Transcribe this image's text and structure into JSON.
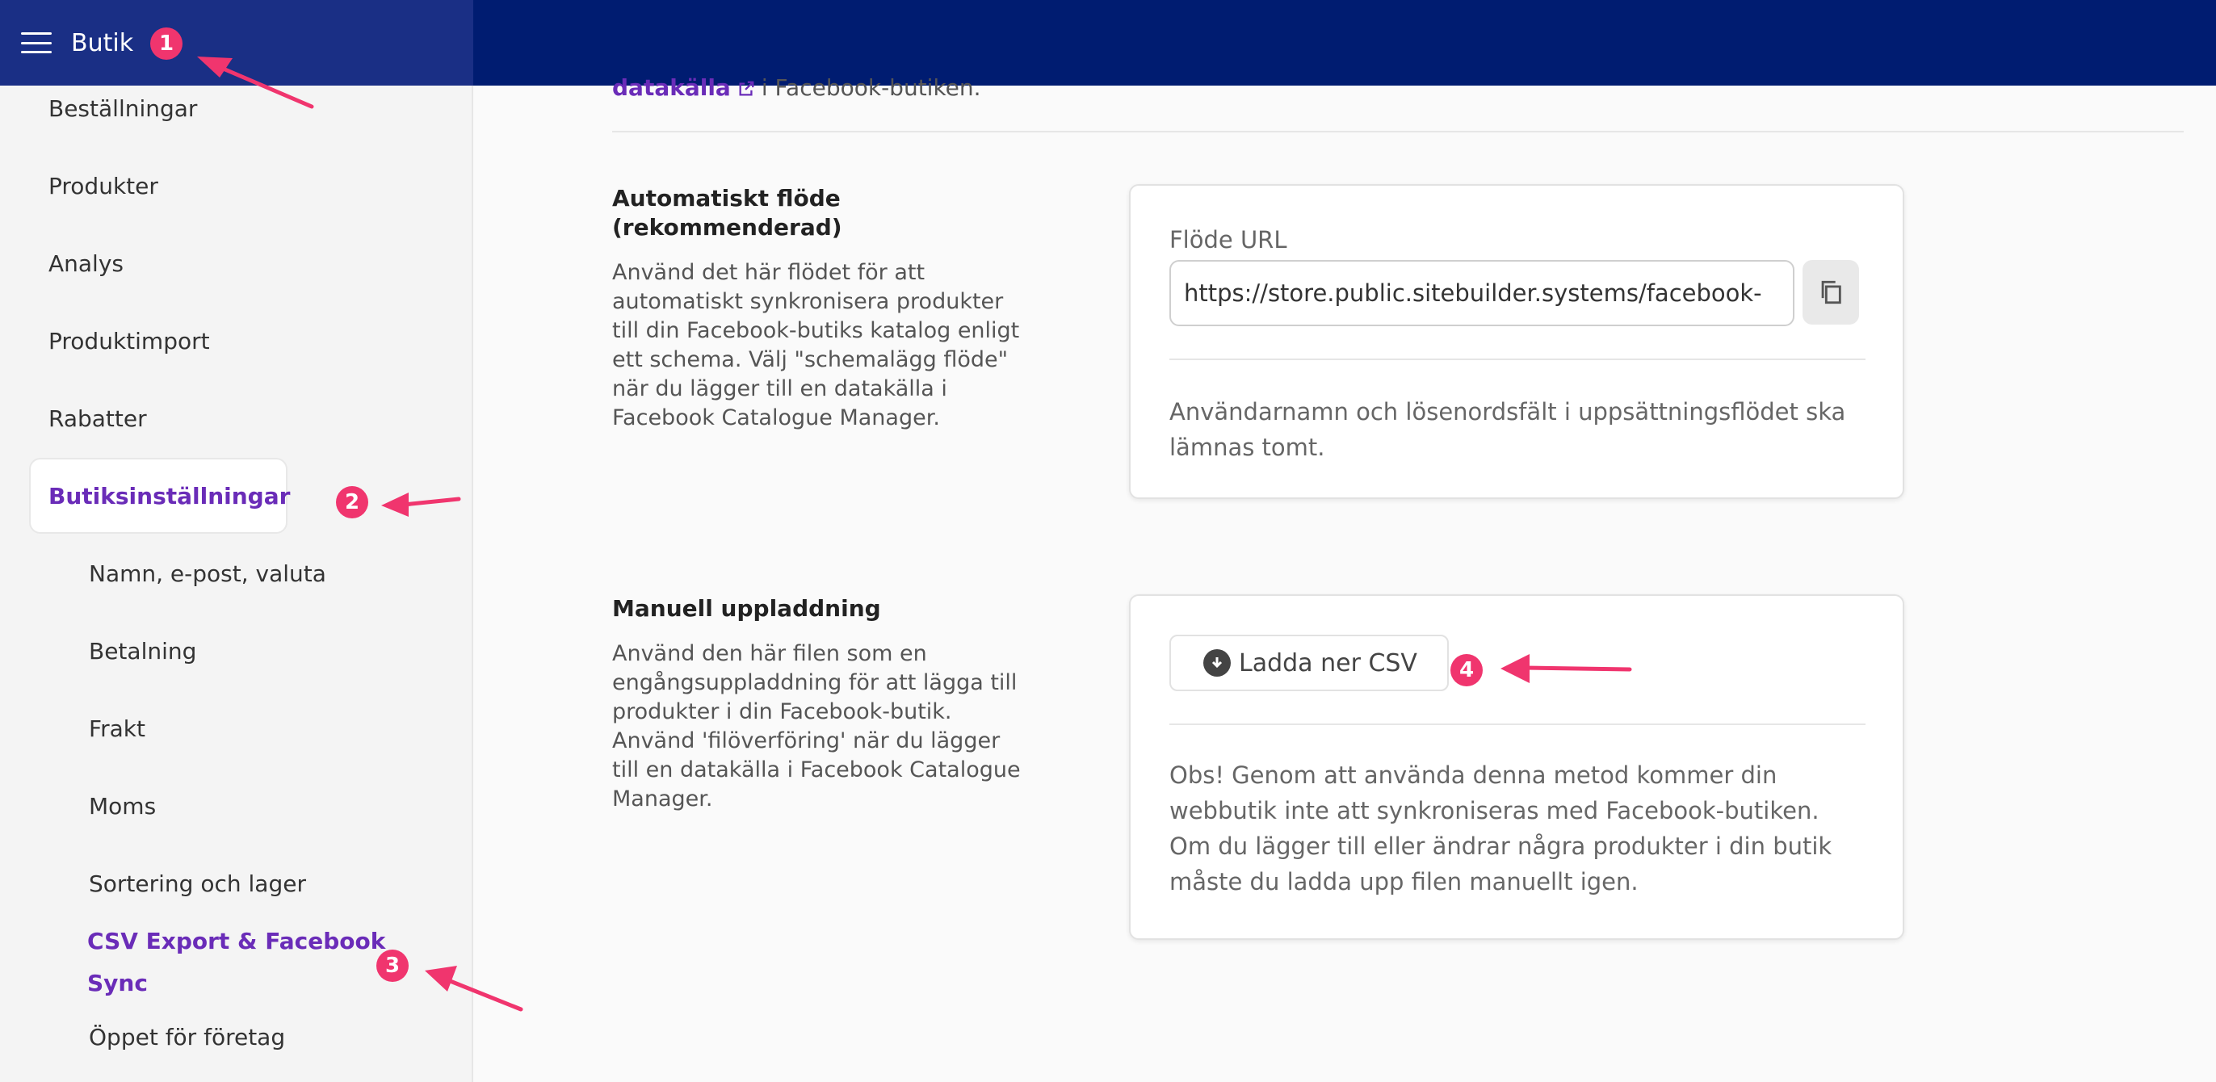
{
  "header": {
    "app_title": "Butik"
  },
  "sidebar": {
    "items": [
      {
        "label": "Beställningar"
      },
      {
        "label": "Produkter"
      },
      {
        "label": "Analys"
      },
      {
        "label": "Produktimport"
      },
      {
        "label": "Rabatter"
      }
    ],
    "active_item": "Butiksinställningar",
    "subitems": [
      {
        "label": "Namn, e-post, valuta"
      },
      {
        "label": "Betalning"
      },
      {
        "label": "Frakt"
      },
      {
        "label": "Moms"
      },
      {
        "label": "Sortering och lager"
      }
    ],
    "active_subitem": "CSV Export & Facebook Sync",
    "last_subitem": "Öppet för företag"
  },
  "main": {
    "top_link": "datakälla",
    "top_text": "i Facebook-butiken.",
    "auto_feed": {
      "title": "Automatiskt flöde (rekommenderad)",
      "description": "Använd det här flödet för att automatiskt synkronisera produkter till din Facebook-butiks katalog enligt ett schema. Välj \"schemalägg flöde\" när du lägger till en datakälla i Facebook Catalogue Manager.",
      "field_label": "Flöde URL",
      "url_value": "https://store.public.sitebuilder.systems/facebook-",
      "note": "Användarnamn och lösenordsfält i uppsättningsflödet ska lämnas tomt."
    },
    "manual_upload": {
      "title": "Manuell uppladdning",
      "description": "Använd den här filen som en engångsuppladdning för att lägga till produkter i din Facebook-butik. Använd 'filöverföring' när du lägger till en datakälla i Facebook Catalogue Manager.",
      "button_label": "Ladda ner CSV",
      "note": "Obs! Genom att använda denna metod kommer din webbutik inte att synkroniseras med Facebook-butiken. Om du lägger till eller ändrar några produkter i din butik måste du ladda upp filen manuellt igen."
    }
  },
  "annotations": [
    "1",
    "2",
    "3",
    "4"
  ],
  "colors": {
    "header": "#001c71",
    "accent": "#6a2cb8",
    "annotation": "#f0356e"
  }
}
